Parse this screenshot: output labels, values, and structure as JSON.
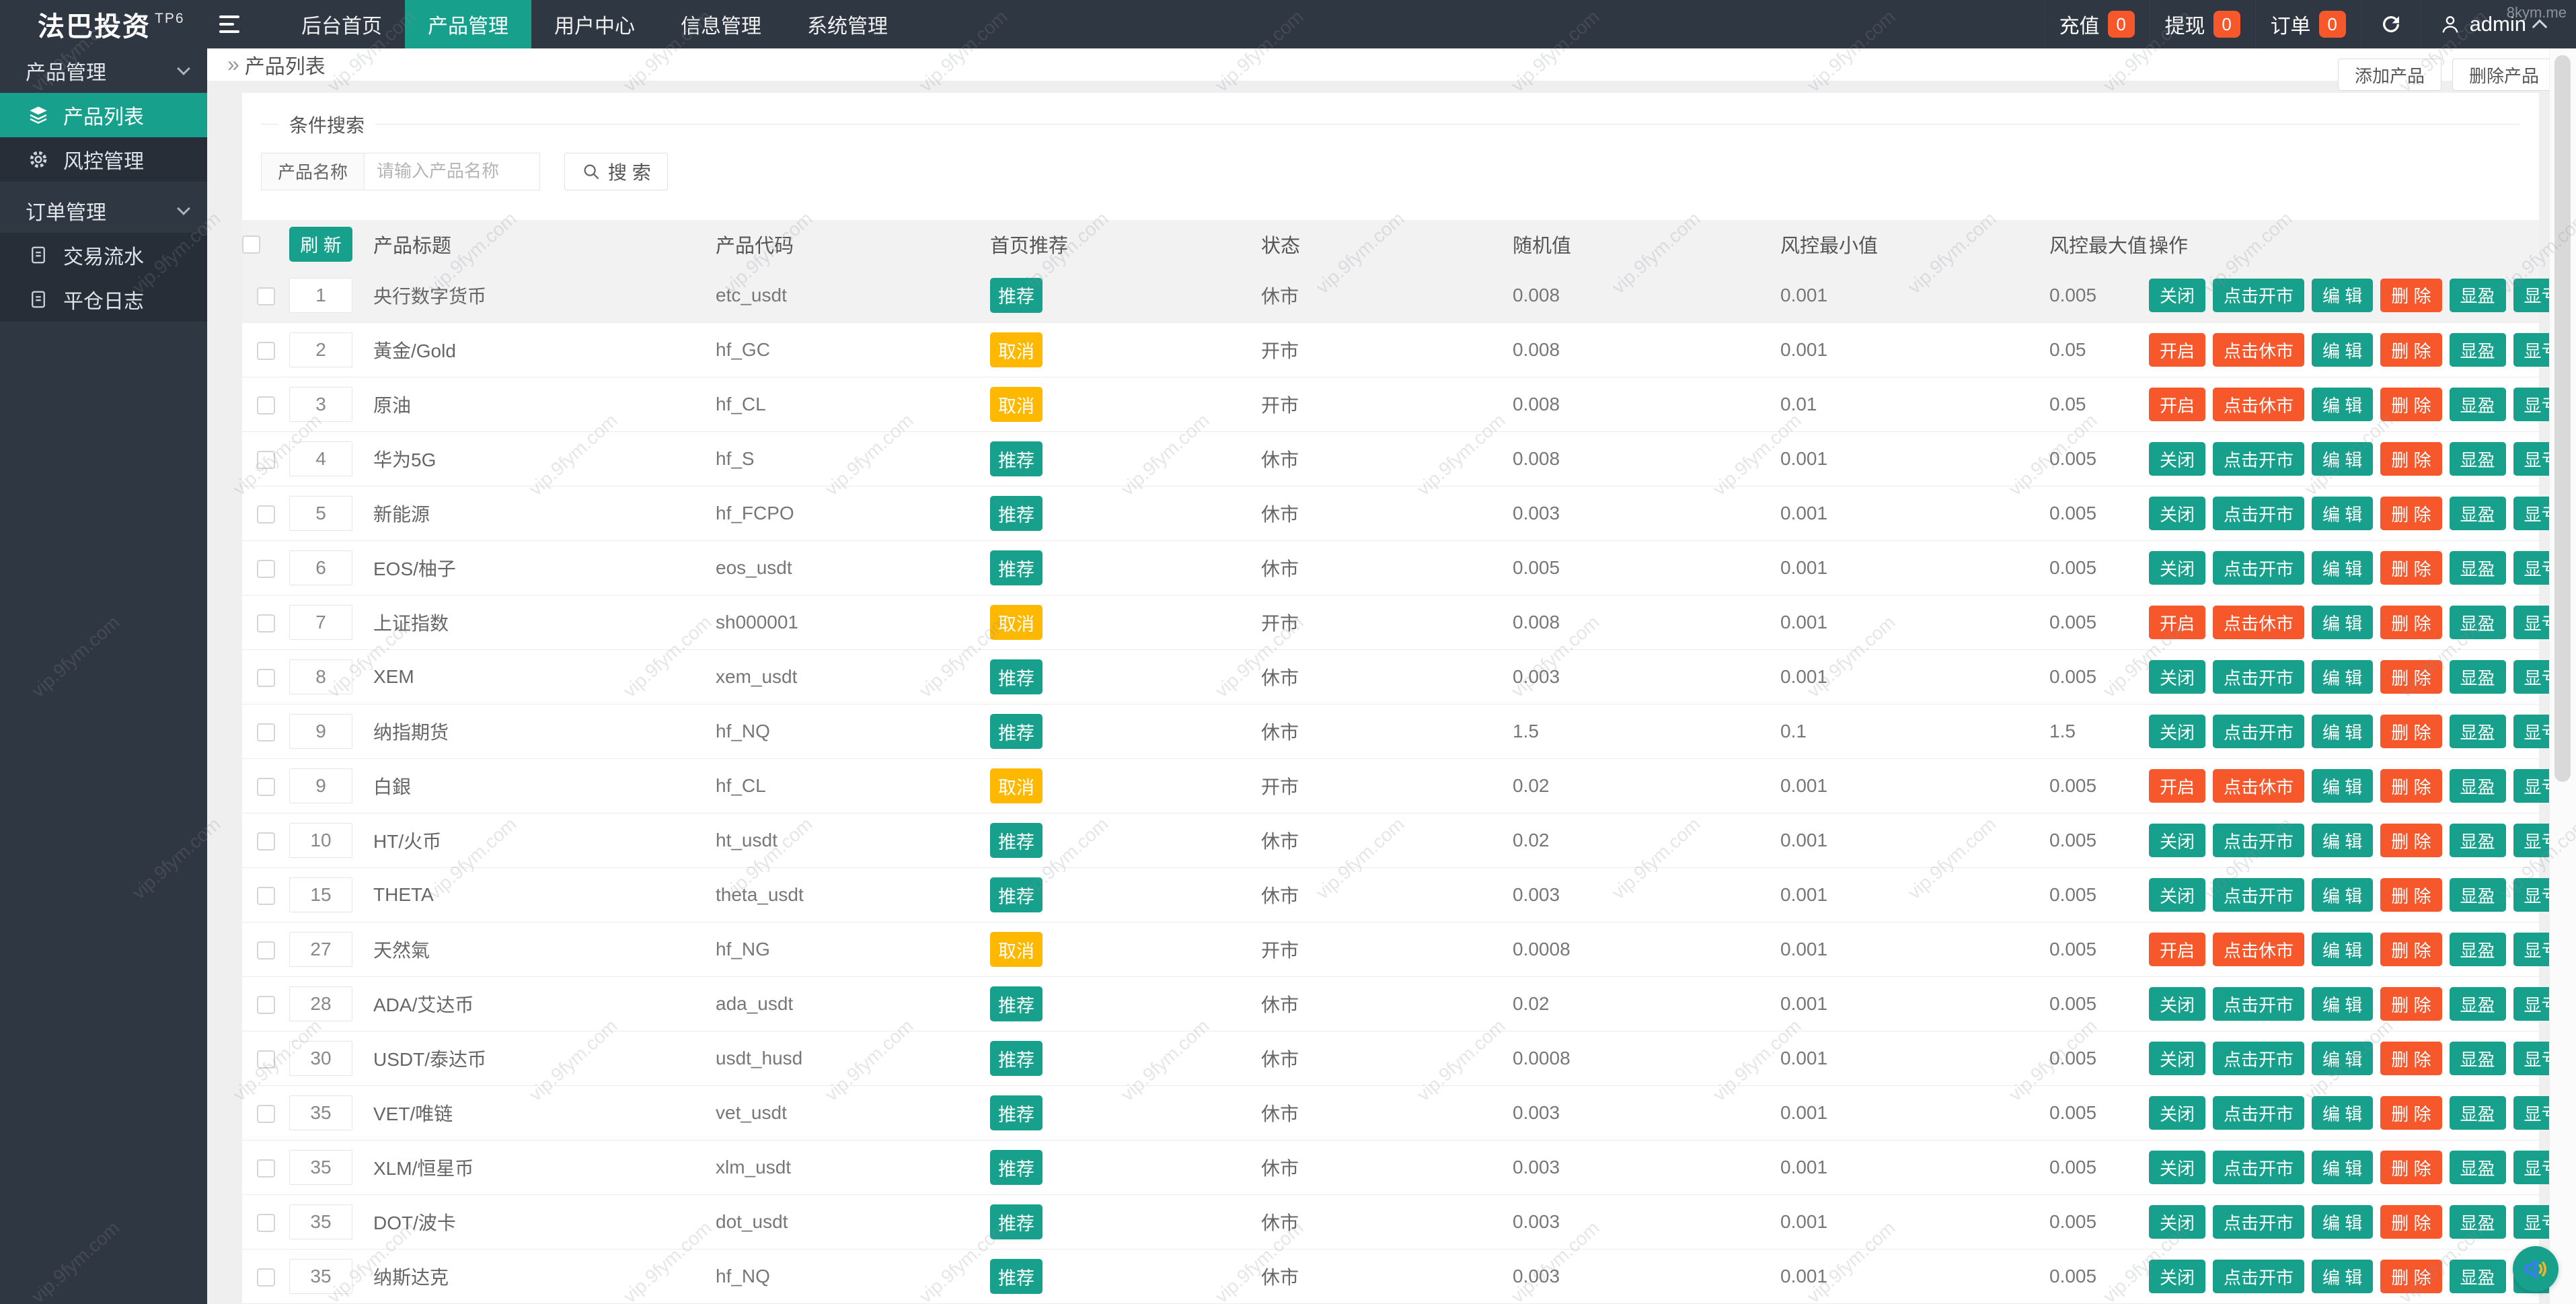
{
  "watermark": {
    "text": "vip.9fym.com",
    "corner": "8kym.me"
  },
  "brand": {
    "name": "法巴投资",
    "tag": "TP6"
  },
  "topnav": {
    "items": [
      "后台首页",
      "产品管理",
      "用户中心",
      "信息管理",
      "系统管理"
    ],
    "active": "产品管理",
    "stats": [
      {
        "label": "充值",
        "count": "0"
      },
      {
        "label": "提现",
        "count": "0"
      },
      {
        "label": "订单",
        "count": "0"
      }
    ],
    "user": {
      "name": "admin"
    }
  },
  "sidebar": {
    "sections": [
      {
        "label": "产品管理",
        "items": [
          {
            "label": "产品列表",
            "icon": "layers-icon",
            "active": true
          },
          {
            "label": "风控管理",
            "icon": "gear-icon",
            "active": false
          }
        ]
      },
      {
        "label": "订单管理",
        "items": [
          {
            "label": "交易流水",
            "icon": "document-icon",
            "active": false
          },
          {
            "label": "平仓日志",
            "icon": "document-icon",
            "active": false
          }
        ]
      }
    ]
  },
  "breadcrumb": {
    "title": "产品列表"
  },
  "page_actions": {
    "add": "添加产品",
    "remove": "删除产品"
  },
  "search": {
    "legend": "条件搜索",
    "field_label": "产品名称",
    "placeholder": "请输入产品名称",
    "button": "搜 索"
  },
  "table": {
    "refresh": "刷 新",
    "headers": {
      "title": "产品标题",
      "code": "产品代码",
      "recommend": "首页推荐",
      "status": "状态",
      "random": "随机值",
      "risk_min": "风控最小值",
      "risk_max": "风控最大值",
      "ops": "操作"
    },
    "ops": {
      "closed": [
        {
          "name": "close",
          "label": "关闭",
          "style": "teal"
        },
        {
          "name": "open-market",
          "label": "点击开市",
          "style": "teal"
        },
        {
          "name": "edit",
          "label": "编 辑",
          "style": "teal"
        },
        {
          "name": "delete",
          "label": "删 除",
          "style": "orange"
        },
        {
          "name": "show-profit",
          "label": "显盈",
          "style": "teal"
        },
        {
          "name": "show-loss",
          "label": "显亏",
          "style": "teal"
        }
      ],
      "open": [
        {
          "name": "enable",
          "label": "开启",
          "style": "orange"
        },
        {
          "name": "close-market",
          "label": "点击休市",
          "style": "orange"
        },
        {
          "name": "edit",
          "label": "编 辑",
          "style": "teal"
        },
        {
          "name": "delete",
          "label": "删 除",
          "style": "orange"
        },
        {
          "name": "show-profit",
          "label": "显盈",
          "style": "teal"
        },
        {
          "name": "show-loss",
          "label": "显亏",
          "style": "teal"
        }
      ]
    },
    "rows": [
      {
        "sort": "1",
        "title": "央行数字货币",
        "code": "etc_usdt",
        "rec": "推荐",
        "recType": "rec",
        "status": "休市",
        "state": "closed",
        "random": "0.008",
        "min": "0.001",
        "max": "0.005"
      },
      {
        "sort": "2",
        "title": "黃金/Gold",
        "code": "hf_GC",
        "rec": "取消",
        "recType": "cancel",
        "status": "开市",
        "state": "open",
        "random": "0.008",
        "min": "0.001",
        "max": "0.05"
      },
      {
        "sort": "3",
        "title": "原油",
        "code": "hf_CL",
        "rec": "取消",
        "recType": "cancel",
        "status": "开市",
        "state": "open",
        "random": "0.008",
        "min": "0.01",
        "max": "0.05"
      },
      {
        "sort": "4",
        "title": "华为5G",
        "code": "hf_S",
        "rec": "推荐",
        "recType": "rec",
        "status": "休市",
        "state": "closed",
        "random": "0.008",
        "min": "0.001",
        "max": "0.005"
      },
      {
        "sort": "5",
        "title": "新能源",
        "code": "hf_FCPO",
        "rec": "推荐",
        "recType": "rec",
        "status": "休市",
        "state": "closed",
        "random": "0.003",
        "min": "0.001",
        "max": "0.005"
      },
      {
        "sort": "6",
        "title": "EOS/柚子",
        "code": "eos_usdt",
        "rec": "推荐",
        "recType": "rec",
        "status": "休市",
        "state": "closed",
        "random": "0.005",
        "min": "0.001",
        "max": "0.005"
      },
      {
        "sort": "7",
        "title": "上证指数",
        "code": "sh000001",
        "rec": "取消",
        "recType": "cancel",
        "status": "开市",
        "state": "open",
        "random": "0.008",
        "min": "0.001",
        "max": "0.005"
      },
      {
        "sort": "8",
        "title": "XEM",
        "code": "xem_usdt",
        "rec": "推荐",
        "recType": "rec",
        "status": "休市",
        "state": "closed",
        "random": "0.003",
        "min": "0.001",
        "max": "0.005"
      },
      {
        "sort": "9",
        "title": "纳指期货",
        "code": "hf_NQ",
        "rec": "推荐",
        "recType": "rec",
        "status": "休市",
        "state": "closed",
        "random": "1.5",
        "min": "0.1",
        "max": "1.5"
      },
      {
        "sort": "9",
        "title": "白銀",
        "code": "hf_CL",
        "rec": "取消",
        "recType": "cancel",
        "status": "开市",
        "state": "open",
        "random": "0.02",
        "min": "0.001",
        "max": "0.005"
      },
      {
        "sort": "10",
        "title": "HT/火币",
        "code": "ht_usdt",
        "rec": "推荐",
        "recType": "rec",
        "status": "休市",
        "state": "closed",
        "random": "0.02",
        "min": "0.001",
        "max": "0.005"
      },
      {
        "sort": "15",
        "title": "THETA",
        "code": "theta_usdt",
        "rec": "推荐",
        "recType": "rec",
        "status": "休市",
        "state": "closed",
        "random": "0.003",
        "min": "0.001",
        "max": "0.005"
      },
      {
        "sort": "27",
        "title": "天然氣",
        "code": "hf_NG",
        "rec": "取消",
        "recType": "cancel",
        "status": "开市",
        "state": "open",
        "random": "0.0008",
        "min": "0.001",
        "max": "0.005"
      },
      {
        "sort": "28",
        "title": "ADA/艾达币",
        "code": "ada_usdt",
        "rec": "推荐",
        "recType": "rec",
        "status": "休市",
        "state": "closed",
        "random": "0.02",
        "min": "0.001",
        "max": "0.005"
      },
      {
        "sort": "30",
        "title": "USDT/泰达币",
        "code": "usdt_husd",
        "rec": "推荐",
        "recType": "rec",
        "status": "休市",
        "state": "closed",
        "random": "0.0008",
        "min": "0.001",
        "max": "0.005"
      },
      {
        "sort": "35",
        "title": "VET/唯链",
        "code": "vet_usdt",
        "rec": "推荐",
        "recType": "rec",
        "status": "休市",
        "state": "closed",
        "random": "0.003",
        "min": "0.001",
        "max": "0.005"
      },
      {
        "sort": "35",
        "title": "XLM/恒星币",
        "code": "xlm_usdt",
        "rec": "推荐",
        "recType": "rec",
        "status": "休市",
        "state": "closed",
        "random": "0.003",
        "min": "0.001",
        "max": "0.005"
      },
      {
        "sort": "35",
        "title": "DOT/波卡",
        "code": "dot_usdt",
        "rec": "推荐",
        "recType": "rec",
        "status": "休市",
        "state": "closed",
        "random": "0.003",
        "min": "0.001",
        "max": "0.005"
      },
      {
        "sort": "35",
        "title": "纳斯达克",
        "code": "hf_NQ",
        "rec": "推荐",
        "recType": "rec",
        "status": "休市",
        "state": "closed",
        "random": "0.003",
        "min": "0.001",
        "max": "0.005"
      }
    ]
  },
  "colors": {
    "teal": "#17A08C",
    "orange": "#F6582C",
    "yellow": "#FFB800",
    "navbar": "#2F3742",
    "badge": "#F6582C"
  }
}
